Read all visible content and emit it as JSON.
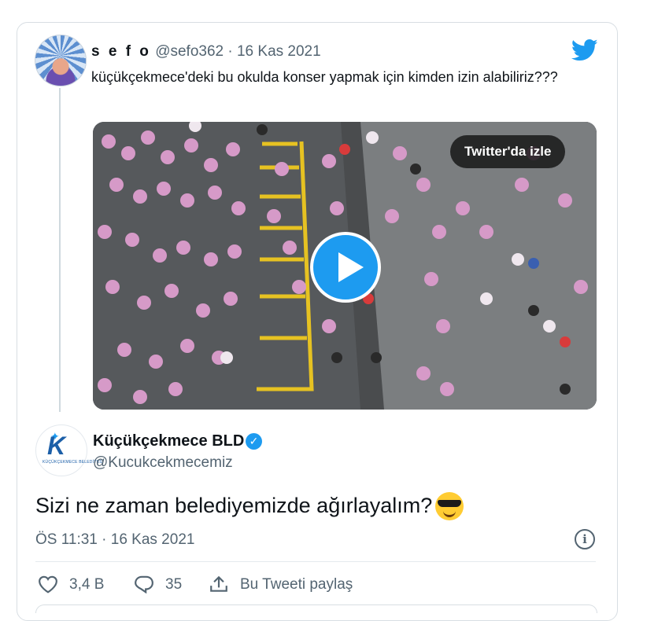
{
  "quoted_tweet": {
    "name": "s e f o",
    "handle": "@sefo362",
    "separator": "·",
    "date": "16 Kas 2021",
    "text": "küçükçekmece'deki bu okulda konser yapmak için kimden izin alabiliriz???",
    "video_button": "Twitter'da izle"
  },
  "reply_tweet": {
    "name": "Küçükçekmece BLD",
    "handle": "@Kucukcekmecemiz",
    "text": "Sizi ne zaman belediyemizde ağırlayalım?",
    "timestamp": "ÖS 11:31 · 16 Kas 2021",
    "logo_text": "KÜÇÜKÇEKMECE BELEDİYESİ"
  },
  "actions": {
    "likes": "3,4 B",
    "replies": "35",
    "share": "Bu Tweeti paylaş"
  },
  "icons": [
    "twitter-bird-icon",
    "play-icon",
    "verified-badge-icon",
    "info-icon",
    "heart-icon",
    "reply-icon",
    "share-icon",
    "sunglasses-emoji"
  ],
  "colors": {
    "accent": "#1d9bf0",
    "text": "#0f1419",
    "muted": "#536471",
    "lane": "#e6c222"
  }
}
